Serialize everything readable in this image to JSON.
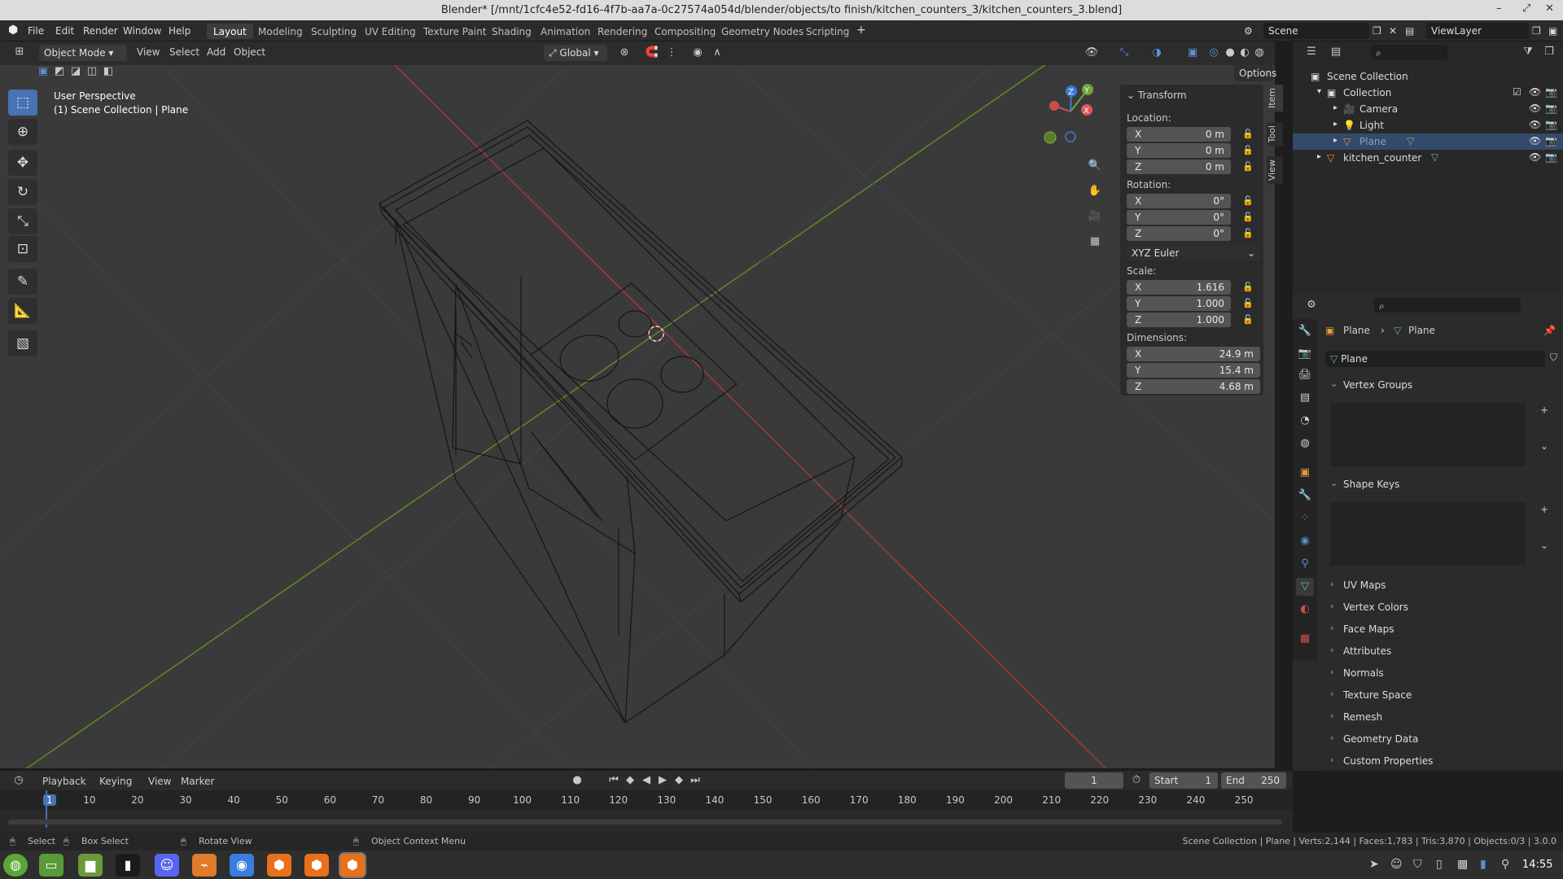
{
  "window": {
    "title": "Blender* [/mnt/1cfc4e52-fd16-4f7b-aa7a-0c27574a054d/blender/objects/to finish/kitchen_counters_3/kitchen_counters_3.blend]"
  },
  "menu": {
    "file": "File",
    "edit": "Edit",
    "render": "Render",
    "window": "Window",
    "help": "Help"
  },
  "workspaces": [
    "Layout",
    "Modeling",
    "Sculpting",
    "UV Editing",
    "Texture Paint",
    "Shading",
    "Animation",
    "Rendering",
    "Compositing",
    "Geometry Nodes",
    "Scripting"
  ],
  "scene": {
    "name": "Scene",
    "view_layer": "ViewLayer"
  },
  "viewport": {
    "mode": "Object Mode",
    "menus": [
      "View",
      "Select",
      "Add",
      "Object"
    ],
    "orientation": "Global",
    "options": "Options",
    "overlay_line1": "User Perspective",
    "overlay_line2": "(1) Scene Collection | Plane"
  },
  "npanel": {
    "section": "Transform",
    "location_label": "Location:",
    "location": {
      "x": "0 m",
      "y": "0 m",
      "z": "0 m"
    },
    "rotation_label": "Rotation:",
    "rotation": {
      "x": "0°",
      "y": "0°",
      "z": "0°"
    },
    "rotation_mode": "XYZ Euler",
    "scale_label": "Scale:",
    "scale": {
      "x": "1.616",
      "y": "1.000",
      "z": "1.000"
    },
    "dimensions_label": "Dimensions:",
    "dimensions": {
      "x": "24.9 m",
      "y": "15.4 m",
      "z": "4.68 m"
    },
    "axes": {
      "x": "X",
      "y": "Y",
      "z": "Z"
    },
    "tabs": [
      "Item",
      "Tool",
      "View"
    ]
  },
  "outliner": {
    "root": "Scene Collection",
    "collection": "Collection",
    "items": [
      "Camera",
      "Light",
      "Plane"
    ],
    "extra": "kitchen_counter"
  },
  "properties": {
    "breadcrumb_obj": "Plane",
    "breadcrumb_data": "Plane",
    "datablock": "Plane",
    "vertex_groups": "Vertex Groups",
    "shape_keys": "Shape Keys",
    "sections": [
      "UV Maps",
      "Vertex Colors",
      "Face Maps",
      "Attributes",
      "Normals",
      "Texture Space",
      "Remesh",
      "Geometry Data",
      "Custom Properties"
    ]
  },
  "timeline": {
    "menus": [
      "Playback",
      "Keying",
      "View",
      "Marker"
    ],
    "current_frame": "1",
    "start_label": "Start",
    "start": "1",
    "end_label": "End",
    "end": "250",
    "ticks": [
      "1",
      "10",
      "20",
      "30",
      "40",
      "50",
      "60",
      "70",
      "80",
      "90",
      "100",
      "110",
      "120",
      "130",
      "140",
      "150",
      "160",
      "170",
      "180",
      "190",
      "200",
      "210",
      "220",
      "230",
      "240",
      "250"
    ]
  },
  "status": {
    "select": "Select",
    "box_select": "Box Select",
    "rotate": "Rotate View",
    "context": "Object Context Menu",
    "stats": "Scene Collection | Plane | Verts:2,144 | Faces:1,783 | Tris:3,870 | Objects:0/3 | 3.0.0"
  },
  "clock": "14:55",
  "colors": {
    "accent": "#4772b3",
    "x_axis": "#c8413f",
    "y_axis": "#6f9a2a",
    "z_axis": "#3f7ad0"
  }
}
